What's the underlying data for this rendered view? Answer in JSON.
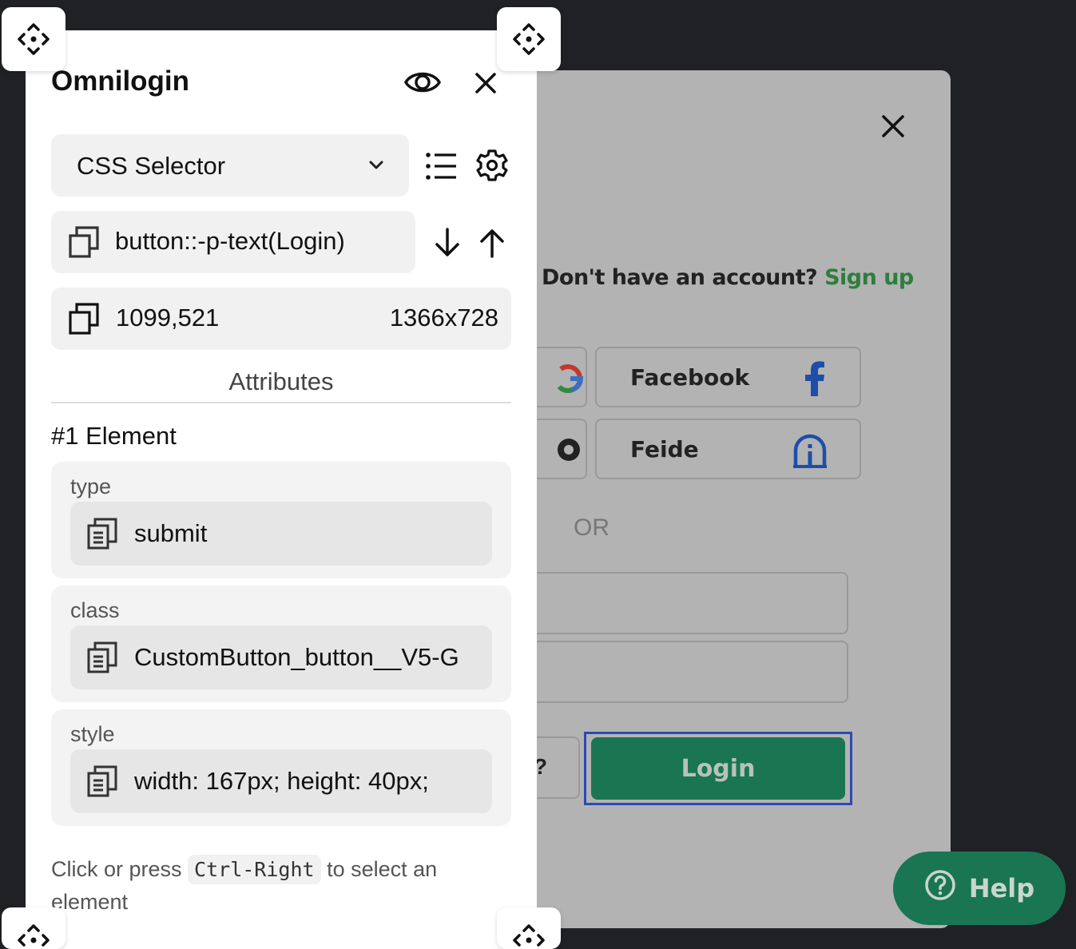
{
  "modal": {
    "signup_prompt": "Don't have an account?",
    "signup_link": "Sign up",
    "sso_buttons": [
      {
        "label": "Facebook",
        "icon": "facebook-icon"
      },
      {
        "label": "Feide",
        "icon": "feide-icon"
      }
    ],
    "or_label": "OR",
    "forgot_fragment": "?",
    "login_label": "Login"
  },
  "help": {
    "label": "Help"
  },
  "panel": {
    "title": "Omnilogin",
    "selector_type": "CSS Selector",
    "selector_value": "button::-p-text(Login)",
    "coordinates": "1099,521",
    "viewport": "1366x728",
    "attributes_title": "Attributes",
    "element_title": "#1 Element",
    "attributes": [
      {
        "name": "type",
        "value": "submit"
      },
      {
        "name": "class",
        "value": "CustomButton_button__V5-G"
      },
      {
        "name": "style",
        "value": "width: 167px; height: 40px;"
      }
    ],
    "hint_before": "Click or press",
    "hint_key": "Ctrl-Right",
    "hint_after": "to select an element"
  },
  "colors": {
    "accent_green": "#1a7552",
    "signup_green": "#2f7d3c",
    "focus_blue": "#2a4bb5"
  }
}
